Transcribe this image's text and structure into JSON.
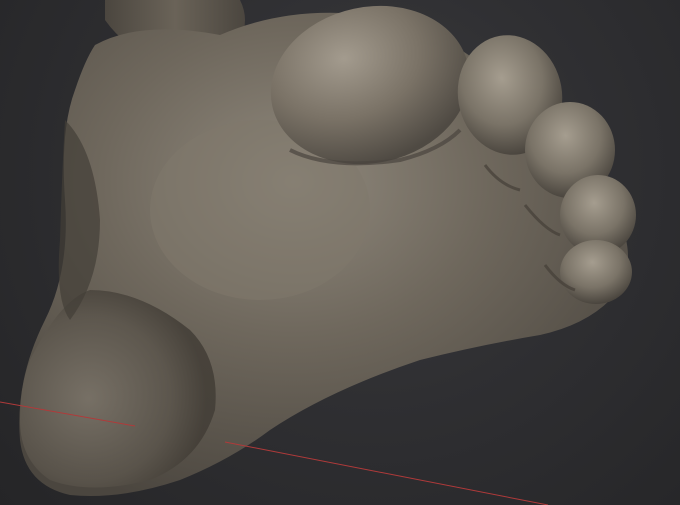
{
  "viewport": {
    "background_color": "#2b2b2d",
    "grid_line_color": "#b03a3a",
    "model_base_color": "#6f685d",
    "model_highlight_color": "#a59d8f",
    "model_shadow_color": "#3f3a33"
  }
}
